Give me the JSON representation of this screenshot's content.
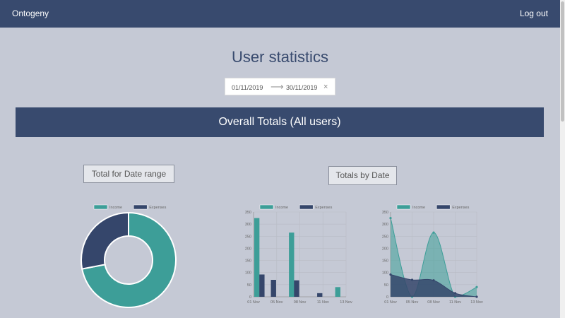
{
  "navbar": {
    "brand": "Ontogeny",
    "logout": "Log out"
  },
  "page_title": "User statistics",
  "daterange": {
    "start": "01/11/2019",
    "arrow": "⟶",
    "end": "30/11/2019",
    "clear": "×"
  },
  "section_title": "Overall Totals (All users)",
  "cards": {
    "date_range_title": "Total for Date range",
    "by_date_title": "Totals by Date"
  },
  "colors": {
    "income": "#3d9e98",
    "expenses": "#35466b",
    "navbar": "#384a6e",
    "background": "#c5c9d5"
  },
  "chart_data": [
    {
      "type": "pie",
      "legend": [
        "Income",
        "Expenses"
      ],
      "legend_position": "top",
      "values": [
        72,
        28
      ]
    },
    {
      "type": "bar",
      "legend": [
        "Income",
        "Expenses"
      ],
      "legend_position": "top",
      "categories": [
        "01 Nov",
        "",
        "05 Nov",
        "",
        "08 Nov",
        "",
        "11 Nov",
        "",
        "13 Nov"
      ],
      "x_tick_labels": [
        "01 Nov",
        "05 Nov",
        "08 Nov",
        "11 Nov",
        "13 Nov"
      ],
      "series": [
        {
          "name": "Income",
          "values": [
            325,
            0,
            0,
            265,
            0,
            0,
            0,
            40
          ]
        },
        {
          "name": "Expenses",
          "values": [
            92,
            70,
            0,
            68,
            0,
            15,
            0,
            0
          ]
        }
      ],
      "ylim": [
        0,
        350
      ],
      "y_ticks": [
        0,
        50,
        100,
        150,
        200,
        250,
        300,
        350
      ],
      "grid": true
    },
    {
      "type": "area",
      "legend": [
        "Income",
        "Expenses"
      ],
      "legend_position": "top",
      "x_tick_labels": [
        "01 Nov",
        "05 Nov",
        "08 Nov",
        "11 Nov",
        "13 Nov"
      ],
      "series": [
        {
          "name": "Income",
          "values": [
            325,
            0,
            265,
            0,
            40
          ]
        },
        {
          "name": "Expenses",
          "values": [
            92,
            70,
            68,
            15,
            0
          ]
        }
      ],
      "ylim": [
        0,
        350
      ],
      "y_ticks": [
        0,
        50,
        100,
        150,
        200,
        250,
        300,
        350
      ],
      "grid": true
    }
  ]
}
